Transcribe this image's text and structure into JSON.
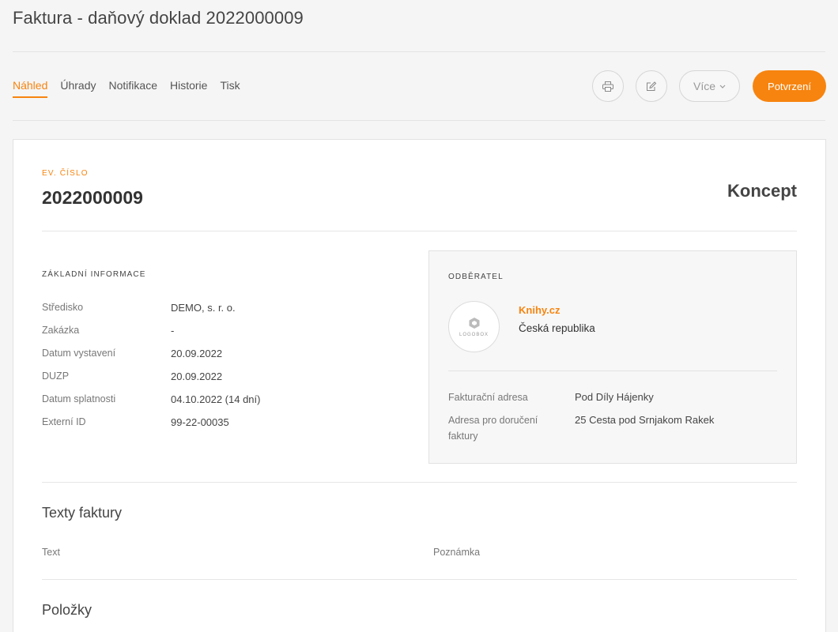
{
  "page": {
    "title": "Faktura - daňový doklad 2022000009"
  },
  "tabs": [
    {
      "label": "Náhled",
      "active": true
    },
    {
      "label": "Úhrady"
    },
    {
      "label": "Notifikace"
    },
    {
      "label": "Historie"
    },
    {
      "label": "Tisk"
    }
  ],
  "toolbar": {
    "print_icon": "printer-icon",
    "edit_icon": "edit-icon",
    "more_label": "Více",
    "confirm_label": "Potvrzení"
  },
  "document": {
    "ev_label": "EV. ČÍSLO",
    "ev_number": "2022000009",
    "status": "Koncept"
  },
  "basic_info": {
    "label": "ZÁKLADNÍ INFORMACE",
    "rows": [
      {
        "key": "Středisko",
        "value": "DEMO, s. r. o."
      },
      {
        "key": "Zakázka",
        "value": "-"
      },
      {
        "key": "Datum vystavení",
        "value": "20.09.2022"
      },
      {
        "key": "DUZP",
        "value": "20.09.2022"
      },
      {
        "key": "Datum splatnosti",
        "value": "04.10.2022 (14 dní)"
      },
      {
        "key": "Externí ID",
        "value": "99-22-00035"
      }
    ]
  },
  "customer": {
    "label": "ODBĚRATEL",
    "logo_text": "LOGOBOX",
    "name": "Knihy.cz",
    "country": "Česká republika",
    "billing_address_label": "Fakturační adresa",
    "billing_address": "Pod Díly Hájenky",
    "delivery_address_label": "Adresa pro doručení faktury",
    "delivery_address": "25 Cesta pod Srnjakom Rakek"
  },
  "invoice_texts": {
    "title": "Texty faktury",
    "text_label": "Text",
    "note_label": "Poznámka"
  },
  "items": {
    "title": "Položky"
  },
  "colors": {
    "accent": "#f7840f"
  }
}
